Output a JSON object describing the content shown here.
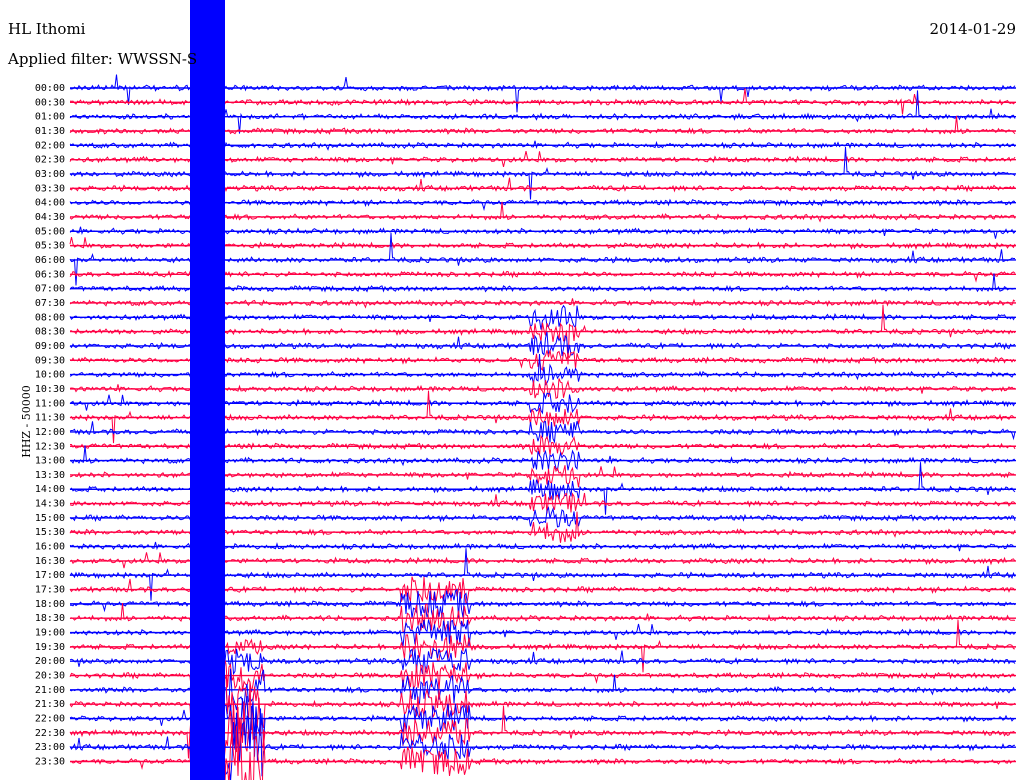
{
  "header": {
    "station": "HL Ithomi",
    "date": "2014-01-29",
    "filter": "Applied filter: WWSSN-S"
  },
  "chart_data": {
    "type": "line",
    "title": "",
    "xlabel": "",
    "ylabel": "HHZ - 50000",
    "categories": [
      "00:00",
      "00:30",
      "01:00",
      "01:30",
      "02:00",
      "02:30",
      "03:00",
      "03:30",
      "04:00",
      "04:30",
      "05:00",
      "05:30",
      "06:00",
      "06:30",
      "07:00",
      "07:30",
      "08:00",
      "08:30",
      "09:00",
      "09:30",
      "10:00",
      "10:30",
      "11:00",
      "11:30",
      "12:00",
      "12:30",
      "13:00",
      "13:30",
      "14:00",
      "14:30",
      "15:00",
      "15:30",
      "16:00",
      "16:30",
      "17:00",
      "17:30",
      "18:00",
      "18:30",
      "19:00",
      "19:30",
      "20:00",
      "20:30",
      "21:00",
      "21:30",
      "22:00",
      "22:30",
      "23:00",
      "23:30"
    ],
    "series": [
      {
        "color": "#0000ff"
      },
      {
        "color": "#ff0044"
      }
    ],
    "grid": false,
    "legend": "none"
  }
}
